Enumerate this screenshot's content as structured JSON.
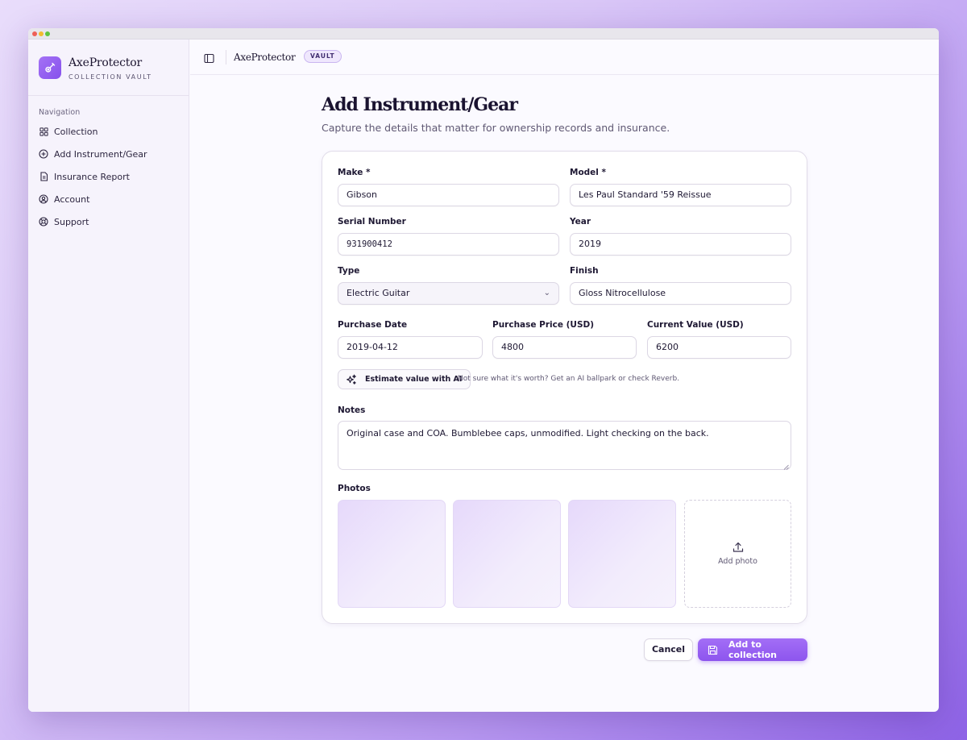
{
  "app": {
    "name": "AxeProtector",
    "subtitle": "COLLECTION VAULT",
    "badge": "VAULT"
  },
  "sidebar": {
    "heading": "Navigation",
    "items": [
      {
        "label": "Collection",
        "icon": "grid-icon"
      },
      {
        "label": "Add Instrument/Gear",
        "icon": "plus-circle-icon"
      },
      {
        "label": "Insurance Report",
        "icon": "document-icon"
      },
      {
        "label": "Account",
        "icon": "user-circle-icon"
      },
      {
        "label": "Support",
        "icon": "lifebuoy-icon"
      }
    ]
  },
  "page": {
    "title": "Add Instrument/Gear",
    "subtitle": "Capture the details that matter for ownership records and insurance."
  },
  "form": {
    "make": {
      "label": "Make *",
      "value": "Gibson"
    },
    "model": {
      "label": "Model *",
      "value": "Les Paul Standard '59 Reissue"
    },
    "serial": {
      "label": "Serial Number",
      "value": "931900412"
    },
    "year": {
      "label": "Year",
      "value": "2019"
    },
    "type": {
      "label": "Type",
      "value": "Electric Guitar"
    },
    "finish": {
      "label": "Finish",
      "value": "Gloss Nitrocellulose"
    },
    "purchase_date": {
      "label": "Purchase Date",
      "value": "2019-04-12"
    },
    "purchase_price": {
      "label": "Purchase Price (USD)",
      "value": "4800"
    },
    "current_value": {
      "label": "Current Value (USD)",
      "value": "6200"
    },
    "ai_button": "Estimate value with AI",
    "ai_hint": "Not sure what it's worth? Get an AI ballpark or check Reverb.",
    "notes": {
      "label": "Notes",
      "value": "Original case and COA. Bumblebee caps, unmodified. Light checking on the back."
    },
    "photos": {
      "label": "Photos",
      "add_label": "Add photo"
    }
  },
  "actions": {
    "cancel": "Cancel",
    "submit": "Add to collection"
  },
  "colors": {
    "accent": "#8d55ee",
    "text": "#1e1833"
  }
}
